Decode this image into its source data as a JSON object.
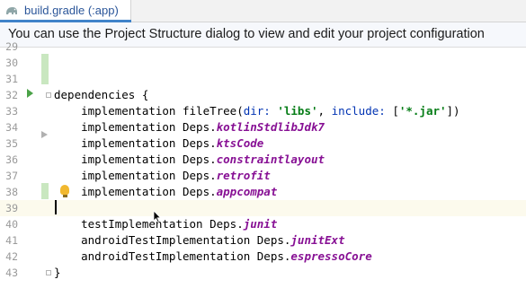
{
  "tab": {
    "title": "build.gradle (:app)"
  },
  "banner": {
    "text": "You can use the Project Structure dialog to view and edit your project configuration"
  },
  "lines": [
    {
      "num": "29",
      "segments": []
    },
    {
      "num": "30",
      "segments": []
    },
    {
      "num": "31",
      "segments": []
    },
    {
      "num": "32",
      "segments": [
        {
          "t": "dependencies {",
          "c": "plain"
        }
      ]
    },
    {
      "num": "33",
      "segments": [
        {
          "t": "    implementation fileTree(",
          "c": "plain"
        },
        {
          "t": "dir: ",
          "c": "kw"
        },
        {
          "t": "'libs'",
          "c": "str"
        },
        {
          "t": ", ",
          "c": "plain"
        },
        {
          "t": "include: ",
          "c": "kw"
        },
        {
          "t": "[",
          "c": "plain"
        },
        {
          "t": "'*.jar'",
          "c": "str"
        },
        {
          "t": "])",
          "c": "plain"
        }
      ]
    },
    {
      "num": "34",
      "segments": [
        {
          "t": "    implementation Deps.",
          "c": "plain"
        },
        {
          "t": "kotlinStdlibJdk7",
          "c": "prop"
        }
      ]
    },
    {
      "num": "35",
      "segments": [
        {
          "t": "    implementation Deps.",
          "c": "plain"
        },
        {
          "t": "ktsCode",
          "c": "prop"
        }
      ]
    },
    {
      "num": "36",
      "segments": [
        {
          "t": "    implementation Deps.",
          "c": "plain"
        },
        {
          "t": "constraintlayout",
          "c": "prop"
        }
      ]
    },
    {
      "num": "37",
      "segments": [
        {
          "t": "    implementation Deps.",
          "c": "plain"
        },
        {
          "t": "retrofit",
          "c": "prop"
        }
      ]
    },
    {
      "num": "38",
      "segments": [
        {
          "t": "    implementation Deps.",
          "c": "plain"
        },
        {
          "t": "appcompat",
          "c": "prop"
        }
      ]
    },
    {
      "num": "39",
      "segments": []
    },
    {
      "num": "40",
      "segments": [
        {
          "t": "    testImplementation Deps.",
          "c": "plain"
        },
        {
          "t": "junit",
          "c": "prop"
        }
      ]
    },
    {
      "num": "41",
      "segments": [
        {
          "t": "    androidTestImplementation Deps.",
          "c": "plain"
        },
        {
          "t": "junitExt",
          "c": "prop"
        }
      ]
    },
    {
      "num": "42",
      "segments": [
        {
          "t": "    androidTestImplementation Deps.",
          "c": "plain"
        },
        {
          "t": "espressoCore",
          "c": "prop"
        }
      ]
    },
    {
      "num": "43",
      "segments": [
        {
          "t": "}",
          "c": "plain"
        }
      ]
    },
    {
      "num": "",
      "segments": []
    }
  ],
  "icons": {
    "tab_icon": "gradle-elephant-icon",
    "run": "run-gutter-icon",
    "fold": "fold-marker-icon",
    "bulb": "intention-bulb-icon"
  },
  "colors": {
    "string": "#067d17",
    "named_arg": "#0033b3",
    "property": "#871094",
    "change_marker": "#c9e7c0",
    "current_line": "#fcfaed",
    "tab_accent": "#4083c9"
  }
}
